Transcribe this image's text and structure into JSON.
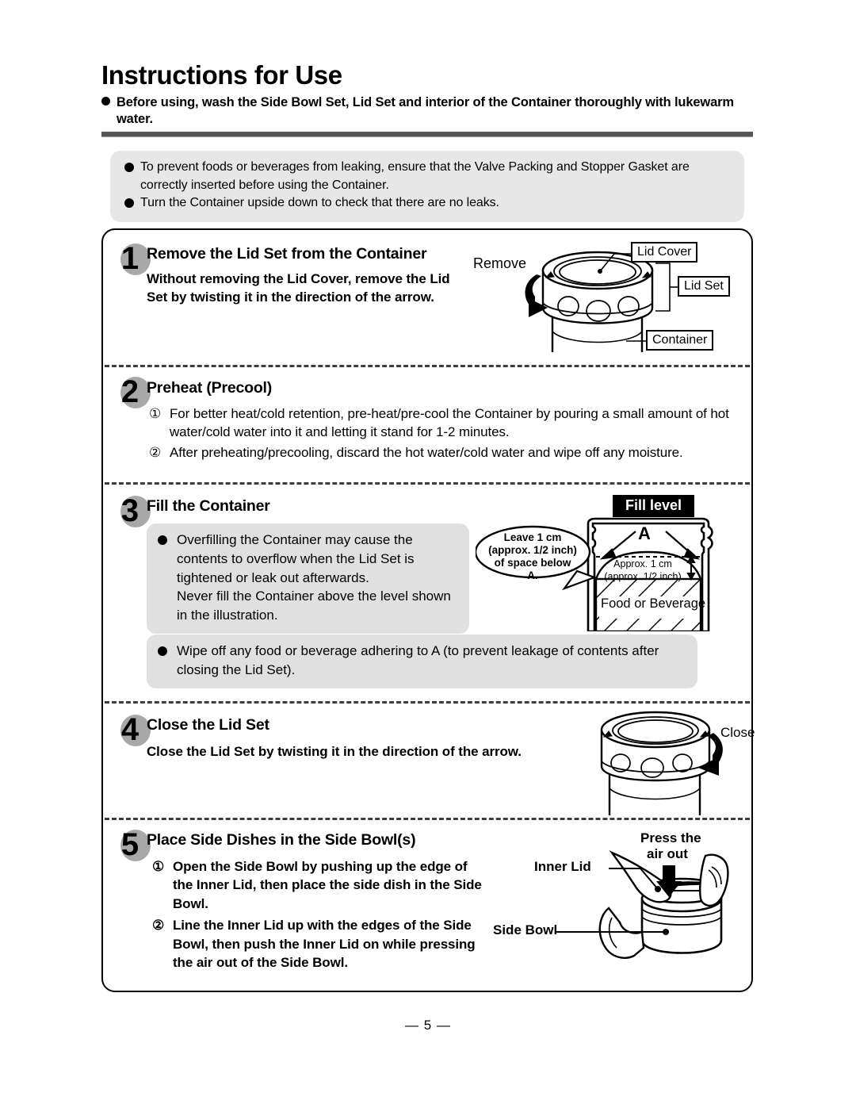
{
  "document": {
    "title": "Instructions for Use",
    "intro_note": "Before using, wash the Side Bowl Set, Lid Set and interior of the Container thoroughly with lukewarm water.",
    "page_number": "— 5 —"
  },
  "caution_box": {
    "lines": [
      "To prevent foods or beverages from leaking, ensure that the Valve Packing and Stopper Gasket are correctly inserted before using the Container.",
      "Turn the Container upside down to check that there are no leaks."
    ]
  },
  "steps": [
    {
      "number": "1",
      "title": "Remove the Lid Set from the Container",
      "body": "Without removing the Lid Cover, remove the Lid Set by twisting it in the direction of the arrow.",
      "illustration": {
        "name": "container-lid-removal",
        "labels": {
          "action": "Remove",
          "lid_cover": "Lid Cover",
          "lid_set": "Lid Set",
          "container": "Container"
        }
      }
    },
    {
      "number": "2",
      "title": "Preheat (Precool)",
      "items": [
        {
          "marker": "①",
          "text": "For better heat/cold retention, pre-heat/pre-cool the Container by pouring a small amount of hot water/cold water into it and letting it stand for 1-2 minutes."
        },
        {
          "marker": "②",
          "text": "After preheating/precooling, discard the hot water/cold water and wipe off any moisture."
        }
      ]
    },
    {
      "number": "3",
      "title": "Fill the Container",
      "gray_boxes": [
        "Overfilling the Container may cause the contents to overflow when the Lid Set is tightened or leak out afterwards.\nNever fill the Container above the level shown in the illustration.",
        "Wipe off any food or beverage adhering to A (to prevent leakage of contents after closing the Lid Set)."
      ],
      "illustration": {
        "name": "fill-level-diagram",
        "banner": "Fill level",
        "callout": "Leave 1 cm (approx. 1/2 inch) of space below A.",
        "callout_lines": [
          "Leave 1 cm",
          "(approx. 1/2 inch)",
          "of space below",
          "A."
        ],
        "area_label": "A",
        "gap_lines": [
          "Approx. 1 cm",
          "(approx. 1/2 inch)"
        ],
        "contents_label": "Food or Beverage"
      }
    },
    {
      "number": "4",
      "title": "Close the Lid Set",
      "body": "Close the Lid Set by twisting it in the direction of the arrow.",
      "illustration": {
        "name": "container-lid-closing",
        "labels": {
          "action": "Close"
        }
      }
    },
    {
      "number": "5",
      "title": "Place Side Dishes in the Side Bowl(s)",
      "items": [
        {
          "marker": "①",
          "text": "Open the Side Bowl by pushing up the edge of the Inner Lid, then place the side dish in the Side Bowl."
        },
        {
          "marker": "②",
          "text": "Line the Inner Lid up with the edges of the Side Bowl, then push the Inner Lid on while pressing the air out of the Side Bowl."
        }
      ],
      "illustration": {
        "name": "side-bowl-inner-lid",
        "labels": {
          "press": "Press the",
          "press2": "air out",
          "inner_lid": "Inner Lid",
          "side_bowl": "Side Bowl"
        }
      }
    }
  ],
  "colors": {
    "rule": "#565656",
    "gray_box": "#e0e0e0",
    "caution_box": "#e7e7e7",
    "step_disc": "#a8a8a8",
    "banner_bg": "#000000"
  }
}
